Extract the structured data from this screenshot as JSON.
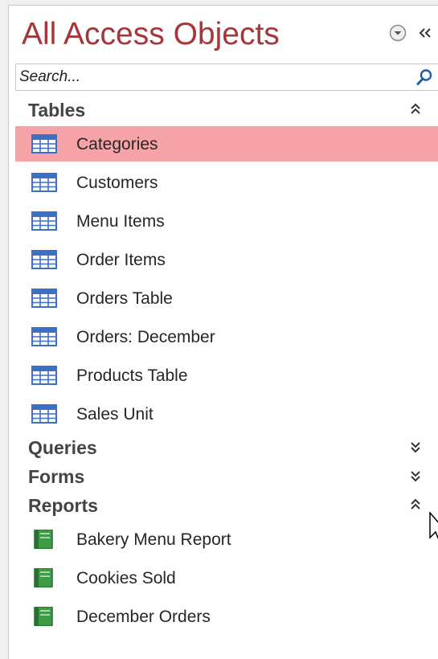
{
  "navigation_pane": {
    "title": "All Access Objects",
    "menu_icon": "dropdown-circle-icon",
    "collapse_icon": "double-chevron-left-icon",
    "search": {
      "placeholder": "Search...",
      "value": "",
      "icon": "search-icon"
    },
    "groups": {
      "tables": {
        "label": "Tables",
        "state": "expanded",
        "items": [
          {
            "label": "Categories",
            "selected": true,
            "icon": "table-icon"
          },
          {
            "label": "Customers",
            "icon": "table-icon"
          },
          {
            "label": "Menu Items",
            "icon": "table-icon"
          },
          {
            "label": "Order Items",
            "icon": "table-icon"
          },
          {
            "label": "Orders Table",
            "icon": "table-icon"
          },
          {
            "label": "Orders: December",
            "icon": "table-icon"
          },
          {
            "label": "Products Table",
            "icon": "table-icon"
          },
          {
            "label": "Sales Unit",
            "icon": "table-icon"
          }
        ]
      },
      "queries": {
        "label": "Queries",
        "state": "collapsed"
      },
      "forms": {
        "label": "Forms",
        "state": "collapsed"
      },
      "reports": {
        "label": "Reports",
        "state": "expanded",
        "items": [
          {
            "label": "Bakery Menu Report",
            "icon": "report-icon"
          },
          {
            "label": "Cookies Sold",
            "icon": "report-icon"
          },
          {
            "label": "December Orders",
            "icon": "report-icon"
          }
        ]
      }
    },
    "colors": {
      "title": "#a4373a",
      "selected_row": "#f5a3a6",
      "group_label": "#444444"
    }
  }
}
